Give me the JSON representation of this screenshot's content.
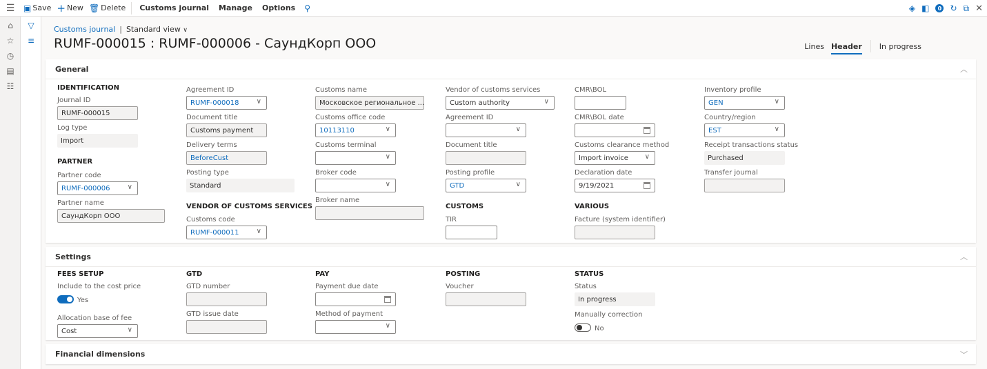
{
  "toolbar": {
    "save_label": "Save",
    "new_label": "New",
    "delete_label": "Delete",
    "customs_journal_label": "Customs journal",
    "manage_label": "Manage",
    "options_label": "Options",
    "notification_count": "0"
  },
  "breadcrumb": {
    "link": "Customs journal",
    "separator": "|",
    "view": "Standard view"
  },
  "page_title": "RUMF-000015 : RUMF-000006 - СаундКорп ООО",
  "right_tabs": {
    "lines": "Lines",
    "header": "Header",
    "status": "In progress"
  },
  "general": {
    "title": "General",
    "identification": {
      "heading": "IDENTIFICATION",
      "journal_id_label": "Journal ID",
      "journal_id": "RUMF-000015",
      "log_type_label": "Log type",
      "log_type": "Import"
    },
    "partner": {
      "heading": "PARTNER",
      "partner_code_label": "Partner code",
      "partner_code": "RUMF-000006",
      "partner_name_label": "Partner name",
      "partner_name": "СаундКорп ООО"
    },
    "col2": {
      "agreement_id_label": "Agreement ID",
      "agreement_id": "RUMF-000018",
      "document_title_label": "Document title",
      "document_title": "Customs payment",
      "delivery_terms_label": "Delivery terms",
      "delivery_terms": "BeforeCust",
      "posting_type_label": "Posting type",
      "posting_type": "Standard",
      "vendor_heading": "VENDOR OF CUSTOMS SERVICES",
      "customs_code_label": "Customs code",
      "customs_code": "RUMF-000011"
    },
    "col3": {
      "customs_name_label": "Customs name",
      "customs_name": "Московское региональное ...",
      "customs_office_code_label": "Customs office code",
      "customs_office_code": "10113110",
      "customs_terminal_label": "Customs terminal",
      "customs_terminal": "",
      "broker_code_label": "Broker code",
      "broker_code": "",
      "broker_name_label": "Broker name",
      "broker_name": ""
    },
    "col4": {
      "vendor_services_label": "Vendor of customs services",
      "vendor_services": "Custom authority",
      "agreement_id_label": "Agreement ID",
      "agreement_id": "",
      "document_title_label": "Document title",
      "document_title": "",
      "posting_profile_label": "Posting profile",
      "posting_profile": "GTD",
      "customs_heading": "CUSTOMS",
      "tir_label": "TIR",
      "tir": ""
    },
    "col5": {
      "cmr_bol_label": "CMR\\BOL",
      "cmr_bol": "",
      "cmr_bol_date_label": "CMR\\BOL date",
      "cmr_bol_date": "",
      "clearance_method_label": "Customs clearance method",
      "clearance_method": "Import invoice",
      "declaration_date_label": "Declaration date",
      "declaration_date": "9/19/2021",
      "various_heading": "VARIOUS",
      "facture_label": "Facture (system identifier)",
      "facture": ""
    },
    "col6": {
      "inventory_profile_label": "Inventory profile",
      "inventory_profile": "GEN",
      "country_region_label": "Country/region",
      "country_region": "EST",
      "receipt_status_label": "Receipt transactions status",
      "receipt_status": "Purchased",
      "transfer_journal_label": "Transfer journal",
      "transfer_journal": ""
    }
  },
  "settings": {
    "title": "Settings",
    "fees": {
      "heading": "FEES SETUP",
      "include_label": "Include to the cost price",
      "include_value": "Yes",
      "include_on": true,
      "allocation_label": "Allocation base of fee",
      "allocation": "Cost"
    },
    "gtd": {
      "heading": "GTD",
      "gtd_number_label": "GTD number",
      "gtd_number": "",
      "gtd_issue_date_label": "GTD issue date",
      "gtd_issue_date": ""
    },
    "pay": {
      "heading": "PAY",
      "due_date_label": "Payment due date",
      "due_date": "",
      "method_label": "Method of payment",
      "method": ""
    },
    "posting": {
      "heading": "POSTING",
      "voucher_label": "Voucher",
      "voucher": ""
    },
    "status": {
      "heading": "STATUS",
      "status_label": "Status",
      "status": "In progress",
      "manual_label": "Manually correction",
      "manual_value": "No",
      "manual_on": false
    }
  },
  "financial": {
    "title": "Financial dimensions"
  },
  "colors": {
    "accent": "#0f6cbd",
    "background": "#faf9f8",
    "readonly_fill": "#f3f2f1"
  }
}
